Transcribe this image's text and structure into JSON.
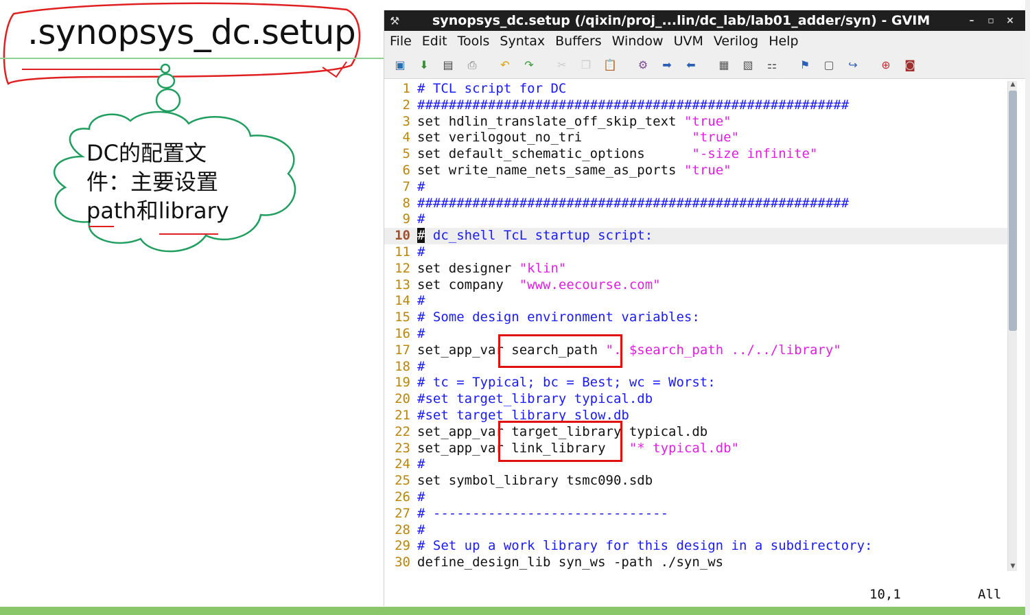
{
  "slide": {
    "title": ".synopsys_dc.setup",
    "cloud_lines": [
      "DC的配置文",
      "件：主要设置",
      "path和library"
    ]
  },
  "window": {
    "title": "synopsys_dc.setup (/qixin/proj_...lin/dc_lab/lab01_adder/syn) - GVIM",
    "minimize": "–",
    "maximize": "▫",
    "close": "×"
  },
  "menu": [
    "File",
    "Edit",
    "Tools",
    "Syntax",
    "Buffers",
    "Window",
    "UVM",
    "Verilog",
    "Help"
  ],
  "toolbar_icons": [
    "open-icon",
    "save-icon",
    "save-all-icon",
    "print-icon",
    "undo-icon",
    "redo-icon",
    "cut-icon",
    "copy-icon",
    "paste-icon",
    "find-replace-icon",
    "find-next-icon",
    "find-prev-icon",
    "load-session-icon",
    "save-session-icon",
    "run-script-icon",
    "make-icon",
    "shell-icon",
    "tags-icon",
    "help-icon",
    "find-help-icon"
  ],
  "lines": [
    {
      "n": "1",
      "parts": [
        [
          "cm",
          "# TCL script for DC"
        ]
      ]
    },
    {
      "n": "2",
      "parts": [
        [
          "cm",
          "#######################################################"
        ]
      ]
    },
    {
      "n": "3",
      "parts": [
        [
          "kw",
          "set hdlin_translate_off_skip_text "
        ],
        [
          "st",
          "\"true\""
        ]
      ]
    },
    {
      "n": "4",
      "parts": [
        [
          "kw",
          "set verilogout_no_tri              "
        ],
        [
          "st",
          "\"true\""
        ]
      ]
    },
    {
      "n": "5",
      "parts": [
        [
          "kw",
          "set default_schematic_options      "
        ],
        [
          "st",
          "\"-size infinite\""
        ]
      ]
    },
    {
      "n": "6",
      "parts": [
        [
          "kw",
          "set write_name_nets_same_as_ports "
        ],
        [
          "st",
          "\"true\""
        ]
      ]
    },
    {
      "n": "7",
      "parts": [
        [
          "cm",
          "#"
        ]
      ]
    },
    {
      "n": "8",
      "parts": [
        [
          "cm",
          "#######################################################"
        ]
      ]
    },
    {
      "n": "9",
      "parts": [
        [
          "cm",
          "#"
        ]
      ]
    },
    {
      "n": "10",
      "parts": [
        [
          "cur",
          "#"
        ],
        [
          "cm",
          " dc_shell TcL startup script:"
        ]
      ],
      "current": true
    },
    {
      "n": "11",
      "parts": [
        [
          "cm",
          "#"
        ]
      ]
    },
    {
      "n": "12",
      "parts": [
        [
          "kw",
          "set designer "
        ],
        [
          "st",
          "\"klin\""
        ]
      ]
    },
    {
      "n": "13",
      "parts": [
        [
          "kw",
          "set company  "
        ],
        [
          "st",
          "\"www.eecourse.com\""
        ]
      ]
    },
    {
      "n": "14",
      "parts": [
        [
          "cm",
          "#"
        ]
      ]
    },
    {
      "n": "15",
      "parts": [
        [
          "cm",
          "# Some design environment variables:"
        ]
      ]
    },
    {
      "n": "16",
      "parts": [
        [
          "cm",
          "#"
        ]
      ]
    },
    {
      "n": "17",
      "parts": [
        [
          "kw",
          "set_app_var search_path "
        ],
        [
          "st",
          "\". $search_path ../../library\""
        ]
      ]
    },
    {
      "n": "18",
      "parts": [
        [
          "cm",
          "#"
        ]
      ]
    },
    {
      "n": "19",
      "parts": [
        [
          "cm",
          "# tc = Typical; bc = Best; wc = Worst:"
        ]
      ]
    },
    {
      "n": "20",
      "parts": [
        [
          "cm",
          "#set target_library typical.db"
        ]
      ]
    },
    {
      "n": "21",
      "parts": [
        [
          "cm",
          "#set target_library slow.db"
        ]
      ]
    },
    {
      "n": "22",
      "parts": [
        [
          "kw",
          "set_app_var target_library typical.db"
        ]
      ]
    },
    {
      "n": "23",
      "parts": [
        [
          "kw",
          "set_app_var link_library   "
        ],
        [
          "st",
          "\"* typical.db\""
        ]
      ]
    },
    {
      "n": "24",
      "parts": [
        [
          "cm",
          "#"
        ]
      ]
    },
    {
      "n": "25",
      "parts": [
        [
          "kw",
          "set symbol_library tsmc090.sdb"
        ]
      ]
    },
    {
      "n": "26",
      "parts": [
        [
          "cm",
          "#"
        ]
      ]
    },
    {
      "n": "27",
      "parts": [
        [
          "cm",
          "# ------------------------------"
        ]
      ]
    },
    {
      "n": "28",
      "parts": [
        [
          "cm",
          "#"
        ]
      ]
    },
    {
      "n": "29",
      "parts": [
        [
          "cm",
          "# Set up a work library for this design in a subdirectory:"
        ]
      ]
    },
    {
      "n": "30",
      "parts": [
        [
          "kw",
          "define_design_lib syn_ws -path ./syn_ws"
        ]
      ]
    }
  ],
  "status": {
    "position": "10,1",
    "scroll": "All"
  },
  "colors": {
    "comment": "#1a1aff",
    "string": "#e020e0",
    "linenr": "#b8860b",
    "annotation": "#e01010"
  }
}
